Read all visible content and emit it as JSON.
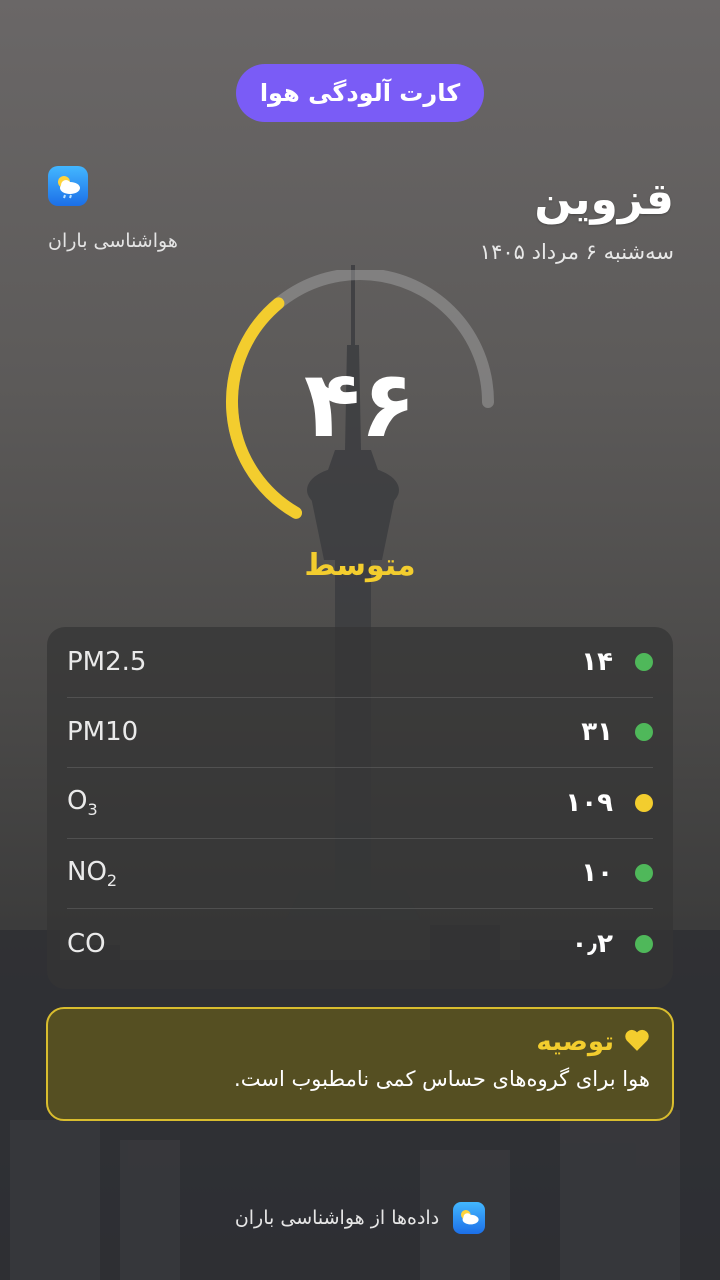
{
  "header": {
    "title": "کارت آلودگی هوا"
  },
  "brand": {
    "name": "هواشناسی باران",
    "icon": "weather-cloud-sun-rain-icon"
  },
  "location": {
    "city": "قزوین",
    "date": "سه‌شنبه ۶ مرداد ۱۴۰۵"
  },
  "aqi": {
    "value": "۴۶",
    "level": 46,
    "max": 100,
    "status": "متوسط",
    "color": "#f3cd2e"
  },
  "pollutants": [
    {
      "name": "PM2.5",
      "sub": "",
      "value": "۱۴",
      "status_color": "#4fb85a"
    },
    {
      "name": "PM10",
      "sub": "",
      "value": "۳۱",
      "status_color": "#4fb85a"
    },
    {
      "name": "O",
      "sub": "3",
      "value": "۱۰۹",
      "status_color": "#f3cd2e"
    },
    {
      "name": "NO",
      "sub": "2",
      "value": "۱۰",
      "status_color": "#4fb85a"
    },
    {
      "name": "CO",
      "sub": "",
      "value": "۰٫۲",
      "status_color": "#4fb85a"
    }
  ],
  "recommendation": {
    "title": "توصیه",
    "icon": "heart-icon",
    "text": "هوا برای گروه‌های حساس کمی نامطبوب است."
  },
  "footer": {
    "text": "داده‌ها از هواشناسی باران",
    "icon": "weather-cloud-sun-rain-icon"
  }
}
